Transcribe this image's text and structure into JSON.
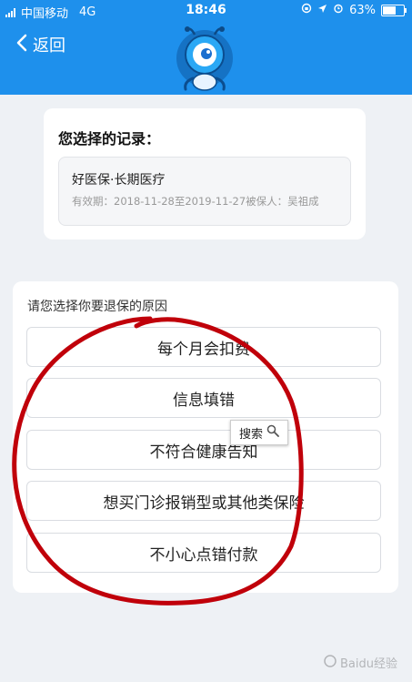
{
  "status_bar": {
    "carrier": "中国移动",
    "network": "4G",
    "time": "18:46",
    "battery": "63%",
    "battery_level": 0.63
  },
  "navbar": {
    "back_label": "返回"
  },
  "record": {
    "title": "您选择的记录：",
    "name": "好医保·长期医疗",
    "meta": "有效期：2018-11-28至2019-11-27被保人：吴祖成"
  },
  "reasons": {
    "prompt": "请您选择你要退保的原因",
    "options": [
      "每个月会扣费",
      "信息填错",
      "不符合健康告知",
      "想买门诊报销型或其他类保险",
      "不小心点错付款"
    ]
  },
  "search_chip": {
    "label": "搜索"
  },
  "watermark": {
    "text": "Baidu经验"
  },
  "colors": {
    "brand_blue": "#1e90ec",
    "annotation_red": "#c0000a"
  }
}
